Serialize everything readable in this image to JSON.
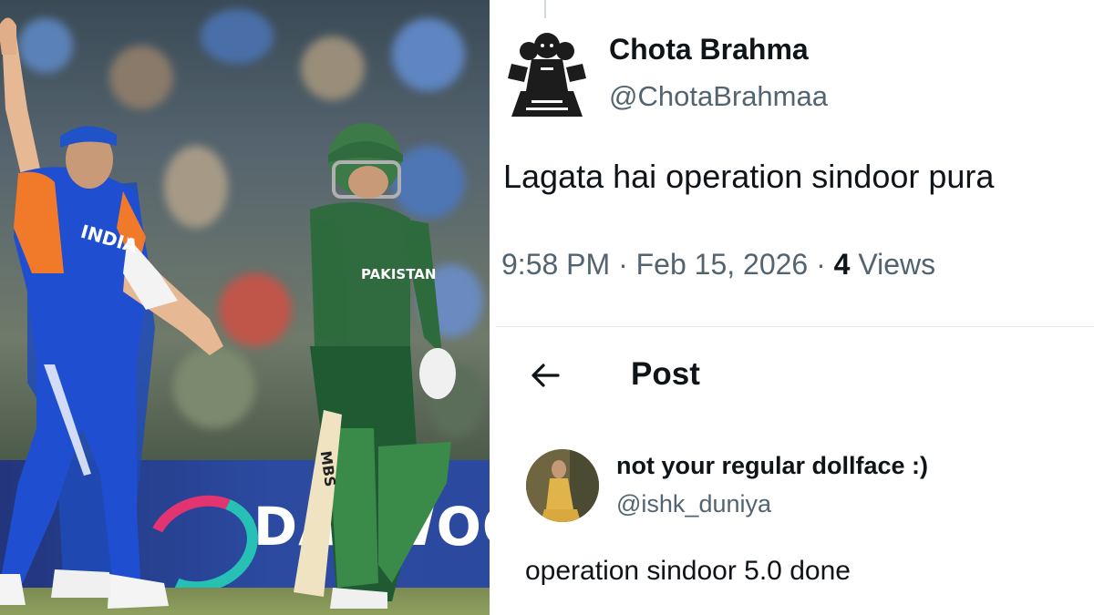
{
  "photo": {
    "description_icon": "cricket-match-photo",
    "jersey_left": "INDIA",
    "jersey_right": "PAKISTAN",
    "bat_brand": "MBS",
    "ad_board_text": "DAEWOO",
    "colors": {
      "india_blue": "#1f4fd0",
      "india_orange": "#f07a2a",
      "pakistan_green": "#2f6b3e",
      "board_blue": "#2b4aa0"
    }
  },
  "tweet": {
    "author_name": "Chota Brahma",
    "author_handle": "@ChotaBrahmaa",
    "text": "Lagata hai operation sindoor pura",
    "time": "9:58 PM",
    "date": "Feb 15, 2026",
    "separator": "·",
    "views_count": "4",
    "views_label": "Views"
  },
  "reply_header": {
    "back_icon": "back-arrow-icon",
    "title": "Post"
  },
  "reply": {
    "author_name": "not your regular dollface :)",
    "author_handle": "@ishk_duniya",
    "text": "operation sindoor 5.0 done"
  },
  "colors": {
    "text_primary": "#0f1419",
    "text_secondary": "#536471",
    "divider": "#e1e8ed"
  }
}
